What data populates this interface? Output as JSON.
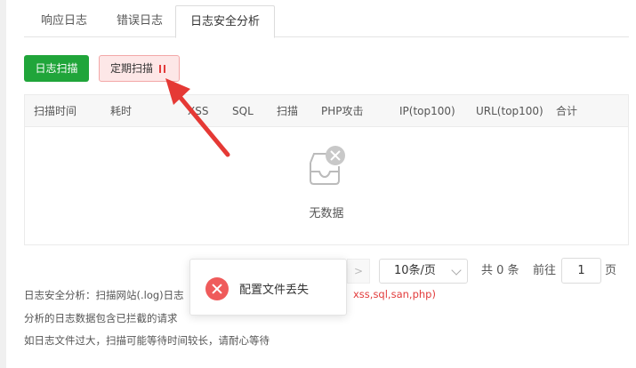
{
  "tabs": [
    {
      "label": "响应日志",
      "active": false
    },
    {
      "label": "错误日志",
      "active": false
    },
    {
      "label": "日志安全分析",
      "active": true
    }
  ],
  "toolbar": {
    "scan_label": "日志扫描",
    "schedule_label": "定期扫描"
  },
  "table": {
    "headers": [
      "扫描时间",
      "耗时",
      "XSS",
      "SQL",
      "扫描",
      "PHP攻击",
      "IP(top100)",
      "URL(top100)",
      "合计"
    ],
    "empty_text": "无数据"
  },
  "pagination": {
    "page_size": "10条/页",
    "total": "共 0 条",
    "goto_label": "前往",
    "page_value": "1",
    "page_suffix": "页"
  },
  "notes": {
    "line1_prefix": "日志安全分析：扫描网站(.log)日志",
    "line1_red": "xss,sql,san,php)",
    "line2": "分析的日志数据包含已拦截的请求",
    "line3": "如日志文件过大，扫描可能等待时间较长，请耐心等待"
  },
  "toast": {
    "message": "配置文件丢失"
  },
  "colors": {
    "primary": "#20a53a",
    "danger": "#e23b3b",
    "schedule_bg": "#fde7e7"
  }
}
